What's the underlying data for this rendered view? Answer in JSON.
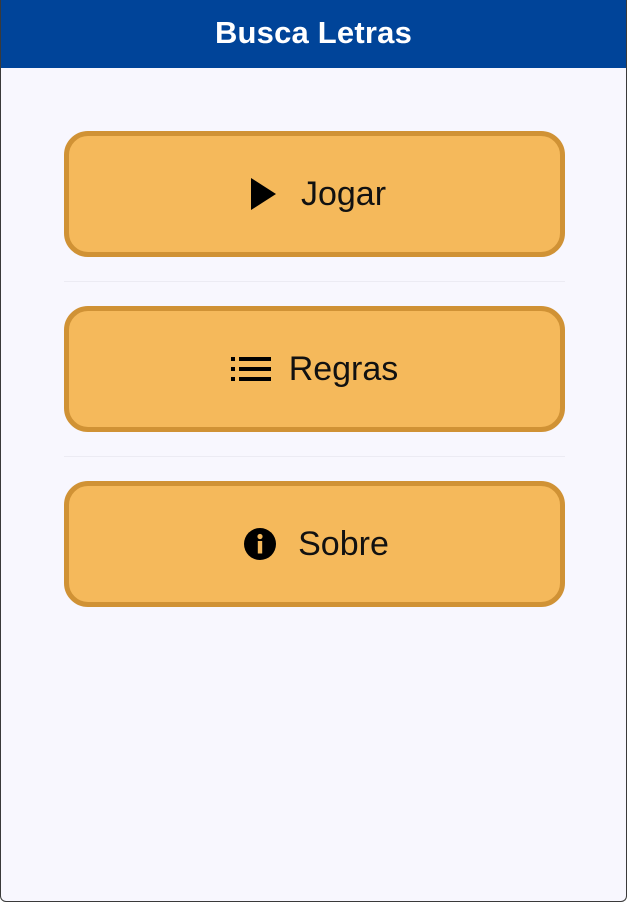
{
  "appbar": {
    "title": "Busca Letras",
    "background": "#004499"
  },
  "menu": {
    "button_color": "#f5b95b",
    "button_border": "#d09235",
    "items": [
      {
        "label": "Jogar",
        "icon": "play-icon"
      },
      {
        "label": "Regras",
        "icon": "list-icon"
      },
      {
        "label": "Sobre",
        "icon": "info-icon"
      }
    ]
  }
}
